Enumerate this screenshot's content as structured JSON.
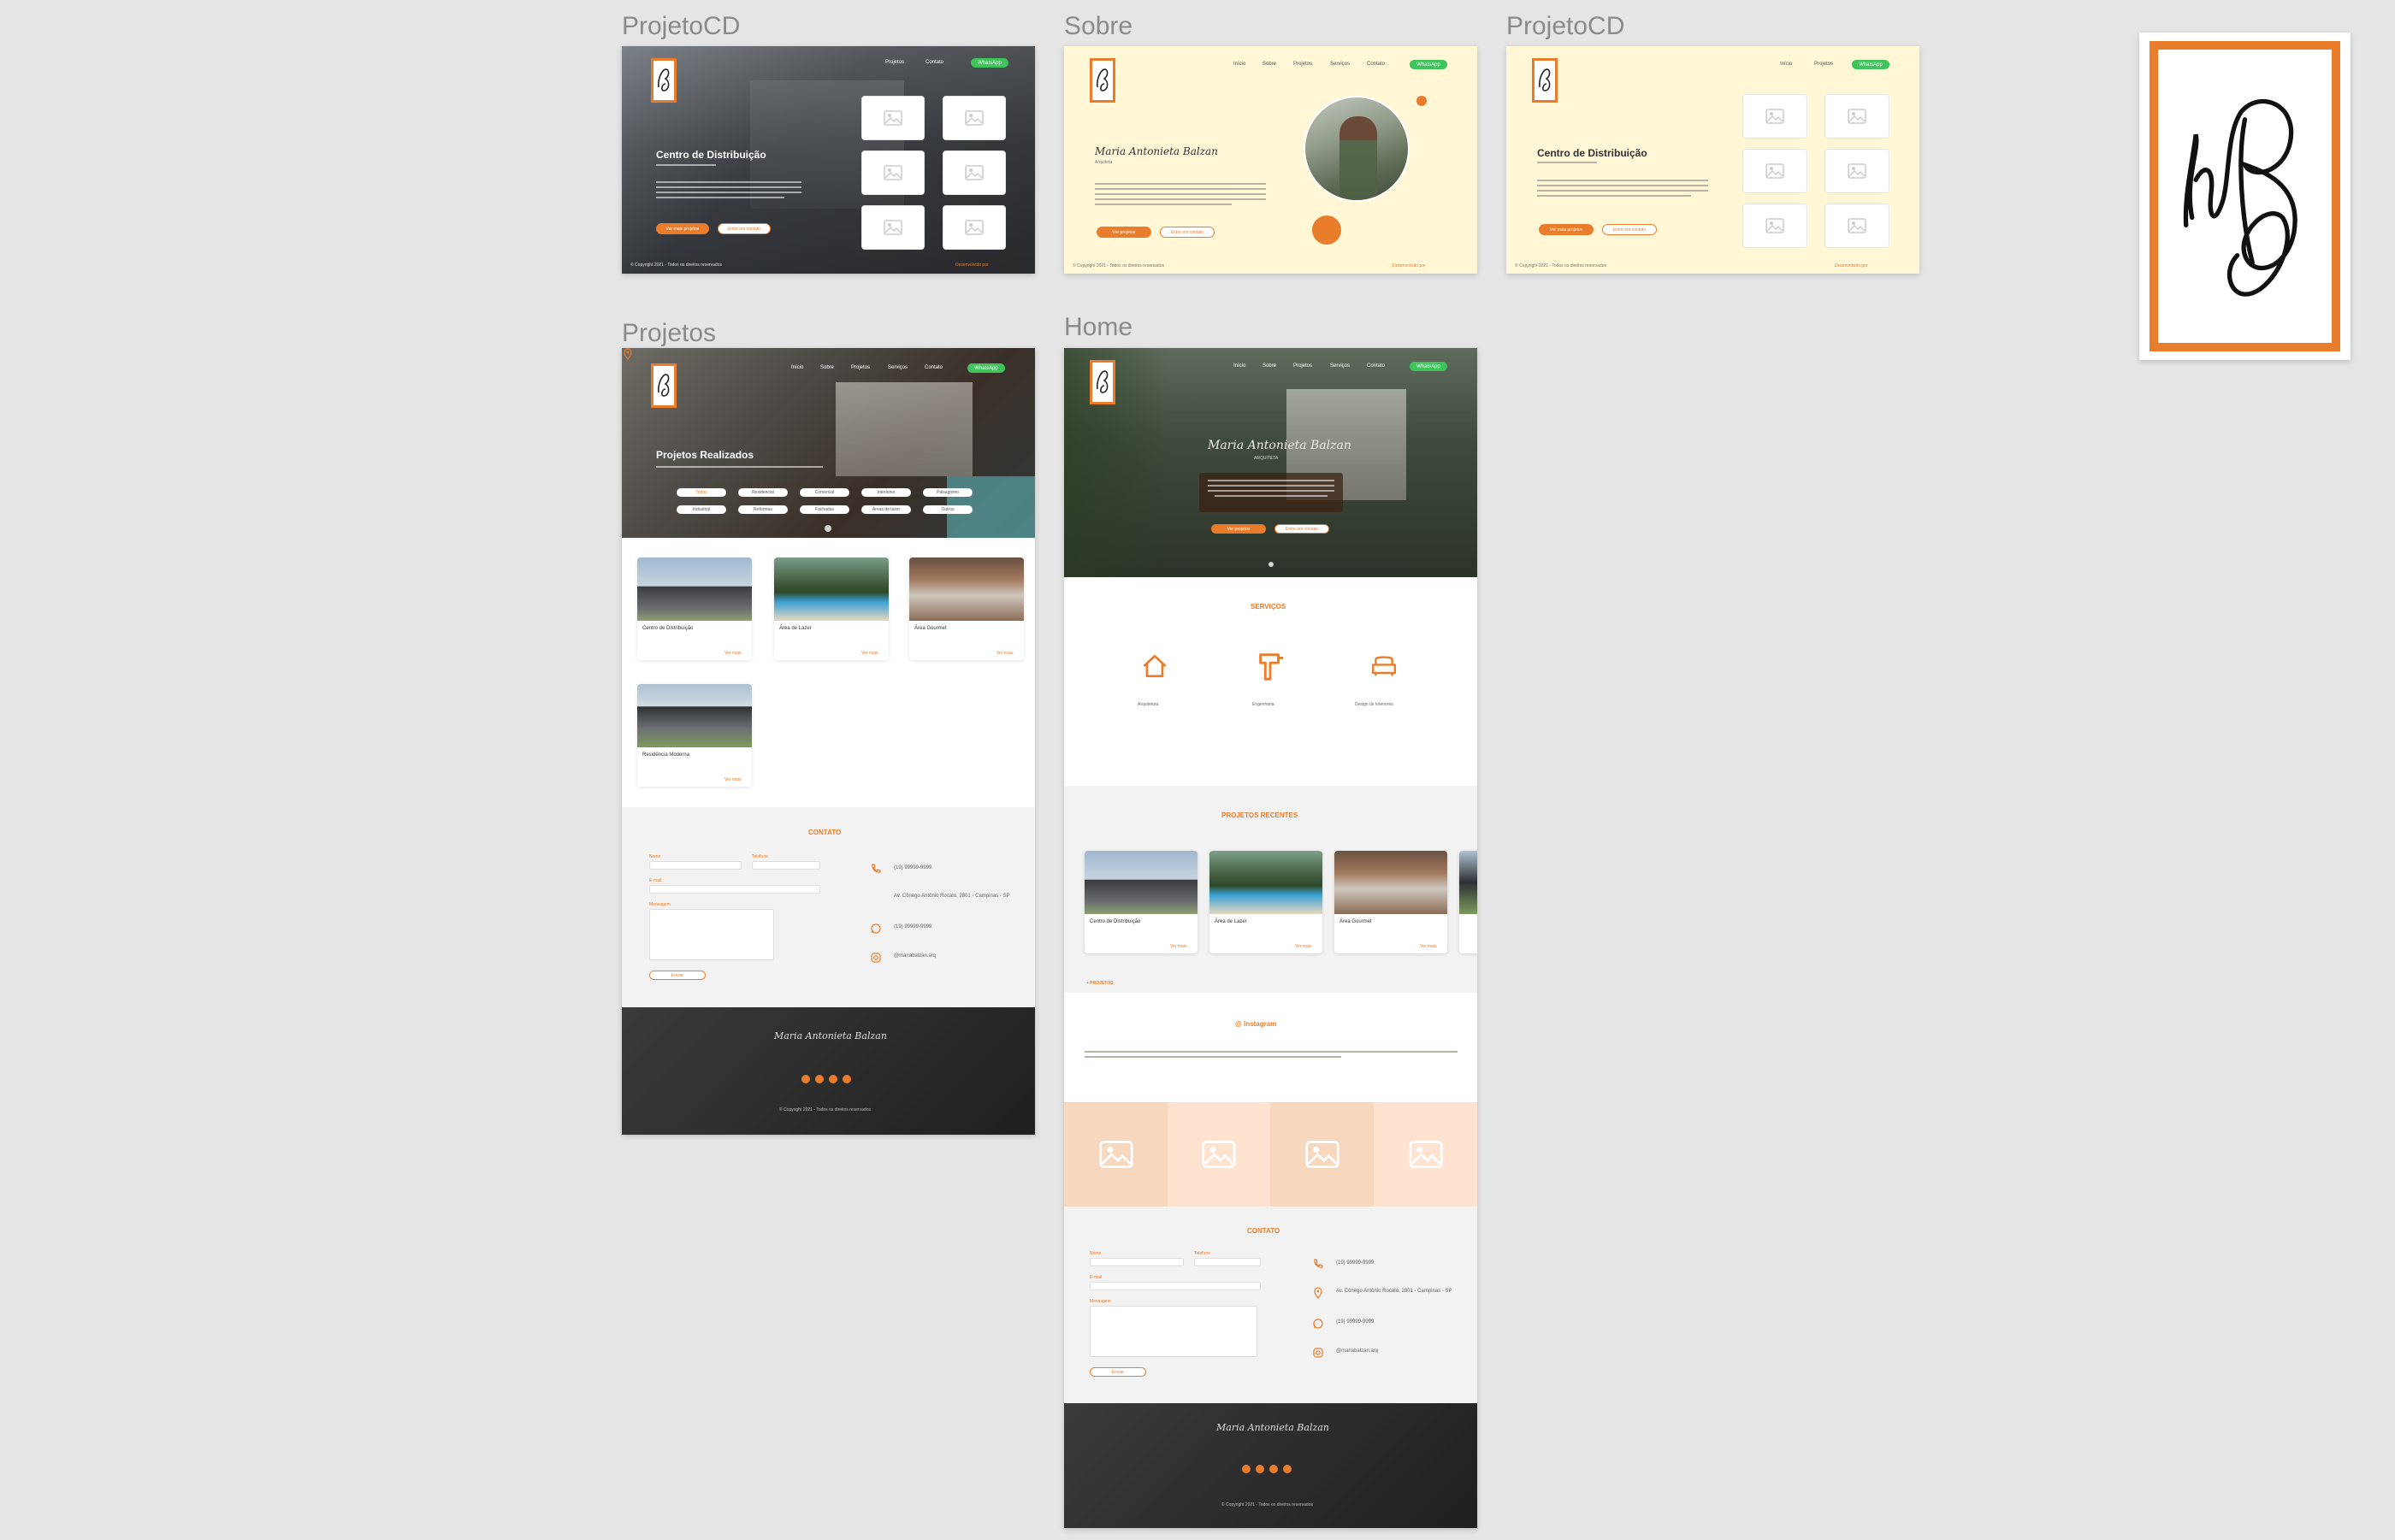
{
  "canvas": {
    "frame_labels": {
      "projetocd_1": "ProjetoCD",
      "sobre": "Sobre",
      "projetocd_2": "ProjetoCD",
      "projetos": "Projetos",
      "home": "Home"
    }
  },
  "colors": {
    "canvas_bg": "#e5e5e5",
    "accent": "#e97d2b",
    "green": "#3ec45a",
    "cream": "#fff7d6",
    "dark_footer": "#2b2b2b"
  },
  "brand": {
    "name": "Maria Antonieta Balzan"
  },
  "projetocd1": {
    "nav": [
      "Projetos",
      "Contato"
    ],
    "nav_cta": "WhatsApp",
    "title": "Centro de Distribuição",
    "btn_primary": "Ver mais projetos",
    "btn_secondary": "Entre em contato",
    "footer_left": "© Copyright 2021 - Todos os direitos reservados",
    "footer_right": "Desenvolvido por"
  },
  "sobre": {
    "nav": [
      "Início",
      "Sobre",
      "Projetos",
      "Serviços",
      "Contato"
    ],
    "nav_cta": "WhatsApp",
    "name": "Maria Antonieta Balzan",
    "role": "Arquiteta",
    "btn_primary": "Ver projetos",
    "btn_secondary": "Entre em contato",
    "footer_left": "© Copyright 2021 - Todos os direitos reservados",
    "footer_right": "Desenvolvido por"
  },
  "projetocd2": {
    "nav": [
      "Início",
      "Projetos"
    ],
    "nav_cta": "WhatsApp",
    "title": "Centro de Distribuição",
    "btn_primary": "Ver mais projetos",
    "btn_secondary": "Entre em contato",
    "footer_left": "© Copyright 2021 - Todos os direitos reservados",
    "footer_right": "Desenvolvido por"
  },
  "projetos": {
    "nav": [
      "Início",
      "Sobre",
      "Projetos",
      "Serviços",
      "Contato"
    ],
    "nav_cta": "WhatsApp",
    "title": "Projetos Realizados",
    "filters": [
      "Todos",
      "Residencial",
      "Comercial",
      "Interiores",
      "Paisagismo",
      "Industrial",
      "Reformas",
      "Fachadas",
      "Áreas de lazer",
      "Outros"
    ],
    "cards": [
      {
        "title": "Centro de Distribuição",
        "link": "Ver mais"
      },
      {
        "title": "Área de Lazer",
        "link": "Ver mais"
      },
      {
        "title": "Área Gourmet",
        "link": "Ver mais"
      },
      {
        "title": "Residência Moderna",
        "link": "Ver mais"
      }
    ],
    "contact_title": "CONTATO",
    "form_labels": [
      "Nome",
      "Telefone",
      "E-mail",
      "Mensagem"
    ],
    "send": "Enviar",
    "contacts": [
      "(19) 99999-9999",
      "Av. Cônego Antônio Rocato, 2801 - Campinas - SP",
      "(19) 99999-9999",
      "@mariabalzan.arq"
    ],
    "footer_copy": "© Copyright 2021 - Todos os direitos reservados"
  },
  "home": {
    "nav": [
      "Início",
      "Sobre",
      "Projetos",
      "Serviços",
      "Contato"
    ],
    "nav_cta": "WhatsApp",
    "subtitle": "ARQUITETA",
    "btn_primary": "Ver projetos",
    "btn_secondary": "Entre em contato",
    "services_title": "SERVIÇOS",
    "services": [
      "Arquitetura",
      "Engenharia",
      "Design de Interiores"
    ],
    "recent_title": "PROJETOS RECENTES",
    "recent_cards": [
      {
        "title": "Centro de Distribuição",
        "link": "Ver mais"
      },
      {
        "title": "Área de Lazer",
        "link": "Ver mais"
      },
      {
        "title": "Área Gourmet",
        "link": "Ver mais"
      }
    ],
    "more_link": "+ PROJETOS",
    "instagram_title": "@ Instagram",
    "contact_title": "CONTATO",
    "form_labels": [
      "Nome",
      "Telefone",
      "E-mail",
      "Mensagem"
    ],
    "send": "Enviar",
    "contacts": [
      "(19) 99999-9999",
      "Av. Cônego Antônio Rocato, 2801 - Campinas - SP",
      "(19) 99999-9999",
      "@mariabalzan.arq"
    ],
    "footer_copy": "© Copyright 2021 - Todos os direitos reservados"
  }
}
